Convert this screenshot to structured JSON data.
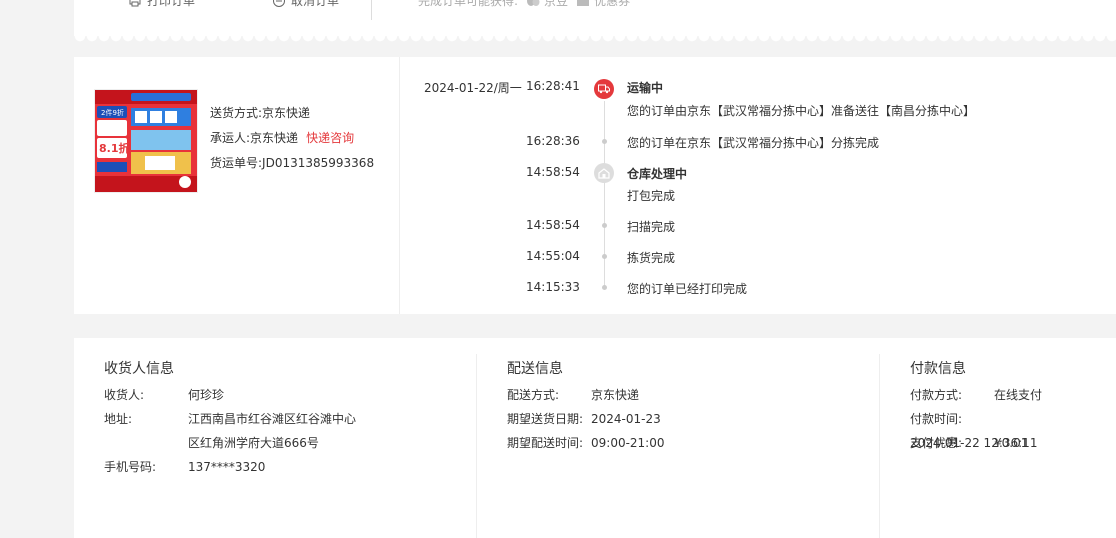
{
  "top": {
    "print_label": "打印订单",
    "cancel_label": "取消订单",
    "benefits_label": "完成订单可能获得:",
    "jingdou": "京豆",
    "coupon": "优惠券"
  },
  "shipping": {
    "method_label": "送货方式:",
    "method_value": "京东快递",
    "carrier_label": "承运人:",
    "carrier_value": "京东快递",
    "carrier_link": "快递咨询",
    "waybill_label": "货运单号:",
    "waybill_value": "JD0131385993368",
    "product_badge_top": "2件9折",
    "product_badge_big": "8.1折"
  },
  "timeline": [
    {
      "date": "2024-01-22/周一",
      "time": "16:28:41",
      "title": "运输中",
      "text": "您的订单由京东【武汉常福分拣中心】准备送往【南昌分拣中心】"
    },
    {
      "time": "16:28:36",
      "text": "您的订单在京东【武汉常福分拣中心】分拣完成"
    },
    {
      "time": "14:58:54",
      "title": "仓库处理中",
      "text": "打包完成"
    },
    {
      "time": "14:58:54",
      "text": "扫描完成"
    },
    {
      "time": "14:55:04",
      "text": "拣货完成"
    },
    {
      "time": "14:15:33",
      "text": "您的订单已经打印完成"
    }
  ],
  "receiver": {
    "title": "收货人信息",
    "name_label": "收货人:",
    "name_value": "何珍珍",
    "addr_label": "地址:",
    "addr_line1": "江西南昌市红谷滩区红谷滩中心",
    "addr_line2": "区红角洲学府大道666号",
    "phone_label": "手机号码:",
    "phone_value": "137****3320"
  },
  "delivery": {
    "title": "配送信息",
    "method_label": "配送方式:",
    "method_value": "京东快递",
    "date_label": "期望送货日期:",
    "date_value": "2024-01-23",
    "time_label": "期望配送时间:",
    "time_value": "09:00-21:00"
  },
  "payment": {
    "title": "付款信息",
    "method_label": "付款方式:",
    "method_value": "在线支付",
    "time_label": "付款时间:",
    "time_value": "2024-01-22 12:36:11",
    "discount_label": "支付优惠:",
    "discount_value": "¥0.01"
  }
}
